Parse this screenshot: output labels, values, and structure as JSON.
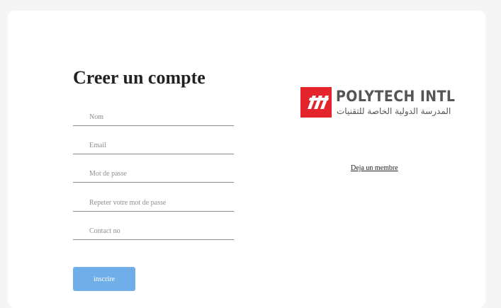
{
  "form": {
    "title": "Creer un compte",
    "fields": [
      {
        "placeholder": "Nom",
        "value": ""
      },
      {
        "placeholder": "Email",
        "value": ""
      },
      {
        "placeholder": "Mot de passe",
        "value": ""
      },
      {
        "placeholder": "Repeter votre mot de passe",
        "value": ""
      },
      {
        "placeholder": "Contact no",
        "value": ""
      }
    ],
    "submit_label": "inscrire"
  },
  "brand": {
    "name": "POLYTECH INTL",
    "arabic_name": "المدرسة الدولية الخاصة للتقنيات",
    "logo_icon": "polytech-logo-icon",
    "accent_color": "#e3242b"
  },
  "login_link": "Deja un membre",
  "colors": {
    "button": "#6faee8",
    "background": "#f5f5f5",
    "card": "#ffffff"
  }
}
